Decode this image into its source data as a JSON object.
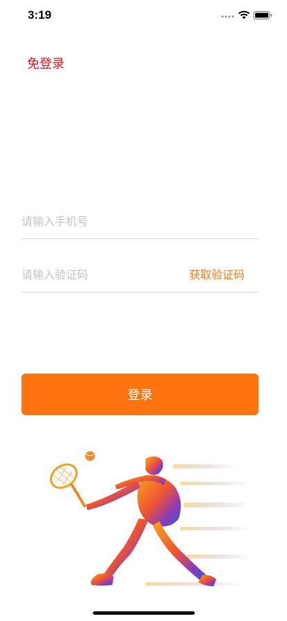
{
  "status_bar": {
    "time": "3:19"
  },
  "header": {
    "skip_login_label": "免登录"
  },
  "form": {
    "phone_placeholder": "请输入手机号",
    "code_placeholder": "请输入验证码",
    "get_code_label": "获取验证码"
  },
  "login_button_label": "登录",
  "colors": {
    "accent": "#ff7410",
    "skip_login": "#e0141e",
    "get_code": "#f5781a"
  },
  "illustration": {
    "icon": "tennis-player-illustration"
  }
}
